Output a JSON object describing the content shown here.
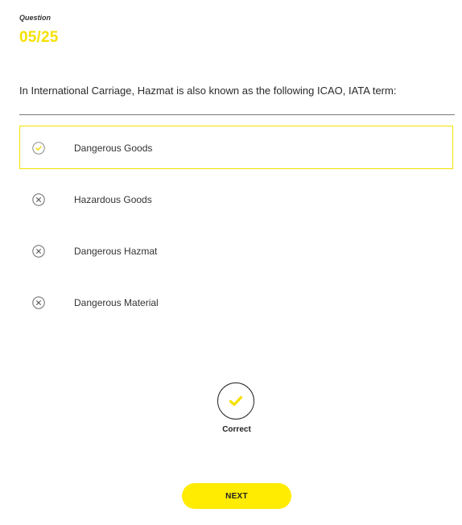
{
  "question": {
    "label": "Question",
    "counter": "05/25",
    "text": "In International Carriage, Hazmat is also known as the following ICAO, IATA term:"
  },
  "options": [
    {
      "label": "Dangerous Goods",
      "icon": "check-circle-icon",
      "selected": true
    },
    {
      "label": "Hazardous Goods",
      "icon": "x-circle-icon",
      "selected": false
    },
    {
      "label": "Dangerous Hazmat",
      "icon": "x-circle-icon",
      "selected": false
    },
    {
      "label": "Dangerous Material",
      "icon": "x-circle-icon",
      "selected": false
    }
  ],
  "result": {
    "icon": "check-icon",
    "label": "Correct"
  },
  "next_button": {
    "label": "NEXT"
  },
  "colors": {
    "accent": "#ffec00",
    "selected_border": "#f2e200",
    "text": "#222222"
  }
}
